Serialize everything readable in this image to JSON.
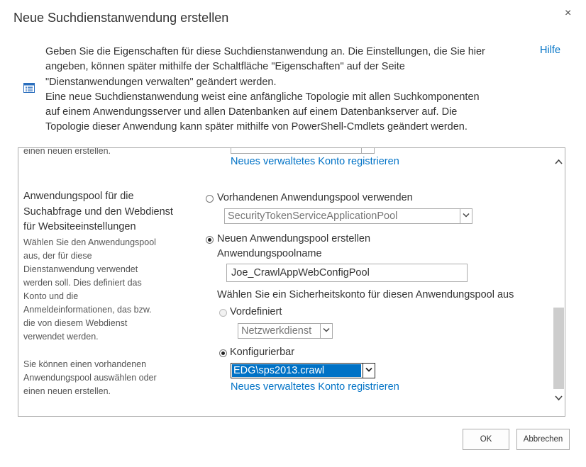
{
  "dialog": {
    "title": "Neue Suchdienstanwendung erstellen",
    "close_symbol": "×",
    "help_label": "Hilfe",
    "intro_lines": [
      "Geben Sie die Eigenschaften für diese Suchdienstanwendung an. Die Einstellungen, die Sie hier",
      "angeben, können später mithilfe der Schaltfläche \"Eigenschaften\" auf der Seite",
      "\"Dienstanwendungen verwalten\" geändert werden.",
      "Eine neue Suchdienstanwendung weist eine anfängliche Topologie mit allen Suchkomponenten",
      "auf einem Anwendungsserver und allen Datenbanken auf einem Datenbankserver auf. Die",
      "Topologie dieser Anwendung kann später mithilfe von PowerShell-Cmdlets geändert werden."
    ]
  },
  "top_section": {
    "left_fragment": "einen neuen erstellen.",
    "register_link": "Neues verwaltetes Konto registrieren"
  },
  "app_pool_section": {
    "heading_lines": [
      "Anwendungspool für die",
      "Suchabfrage und den Webdienst",
      "für Websiteeinstellungen"
    ],
    "description_lines": [
      "Wählen Sie den Anwendungspool",
      "aus, der für diese",
      "Dienstanwendung verwendet",
      "werden soll. Dies definiert das",
      "Konto und die",
      "Anmeldeinformationen, das bzw.",
      "die von diesem Webdienst",
      "verwendet werden."
    ],
    "description2_lines": [
      "Sie können einen vorhandenen",
      "Anwendungspool auswählen oder",
      "einen neuen erstellen."
    ],
    "use_existing_label": "Vorhandenen Anwendungspool verwenden",
    "existing_pool_value": "SecurityTokenServiceApplicationPool",
    "create_new_label": "Neuen Anwendungspool erstellen",
    "pool_name_label": "Anwendungspoolname",
    "pool_name_value": "Joe_CrawlAppWebConfigPool",
    "security_account_label": "Wählen Sie ein Sicherheitskonto für diesen Anwendungspool aus",
    "predefined_label": "Vordefiniert",
    "predefined_value": "Netzwerkdienst",
    "configurable_label": "Konfigurierbar",
    "configurable_value": "EDG\\sps2013.crawl",
    "register_link": "Neues verwaltetes Konto registrieren"
  },
  "footer": {
    "ok_label": "OK",
    "cancel_label": "Abbrechen"
  },
  "colors": {
    "link": "#0072c6",
    "selection": "#0072c6"
  }
}
